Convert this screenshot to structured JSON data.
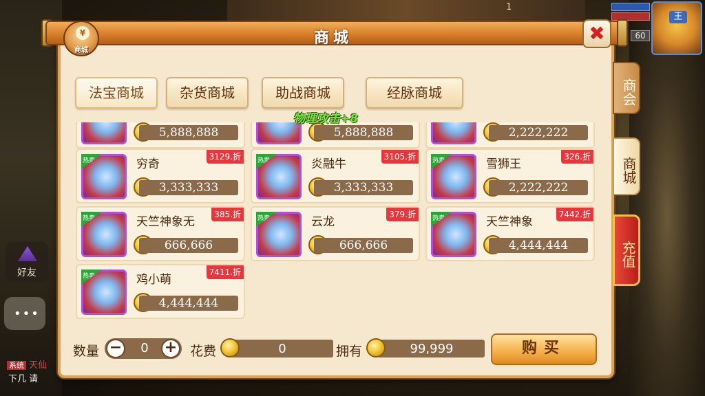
{
  "window": {
    "title": "商城",
    "top_status": "1"
  },
  "shop_icon": {
    "symbol": "¥",
    "label": "商城"
  },
  "close_icon": "close-icon",
  "hud": {
    "level": "60",
    "avatar_mark": "王"
  },
  "tabs": [
    {
      "label": "法宝商城",
      "active": true
    },
    {
      "label": "杂货商城",
      "active": false
    },
    {
      "label": "助战商城",
      "active": false
    },
    {
      "label": "经脉商城",
      "active": false
    }
  ],
  "floating_text": "物理攻击+8",
  "item_tag": "热卖",
  "items": [
    {
      "name": "",
      "discount": "",
      "price": "5,888,888"
    },
    {
      "name": "",
      "discount": "",
      "price": "5,888,888"
    },
    {
      "name": "",
      "discount": "",
      "price": "2,222,222"
    },
    {
      "name": "穷奇",
      "discount": "3129.折",
      "price": "3,333,333"
    },
    {
      "name": "炎融牛",
      "discount": "3105.折",
      "price": "3,333,333"
    },
    {
      "name": "雪狮王",
      "discount": "326.折",
      "price": "2,222,222"
    },
    {
      "name": "天竺神象无",
      "discount": "385.折",
      "price": "666,666"
    },
    {
      "name": "云龙",
      "discount": "379.折",
      "price": "666,666"
    },
    {
      "name": "天竺神象",
      "discount": "7442.折",
      "price": "4,444,444"
    },
    {
      "name": "鸡小萌",
      "discount": "7411.折",
      "price": "4,444,444"
    }
  ],
  "bottom": {
    "quantity_label": "数量",
    "quantity_value": "0",
    "minus": "−",
    "plus": "+",
    "cost_label": "花费",
    "cost_value": "0",
    "own_label": "拥有",
    "own_value": "99,999",
    "buy_label": "购买"
  },
  "side_tabs": {
    "guild": "商会",
    "shop": "商城",
    "recharge": "充值"
  },
  "left_ui": {
    "friends_label": "好友",
    "chat_dots": "•••",
    "chat_tag": "系统",
    "chat_text": "天仙",
    "chat_line2": "下几 请"
  },
  "colors": {
    "panel_bg": "#f6e8cf",
    "title_orange": "#d87f2a",
    "discount_red": "#e8363c",
    "float_green": "#7ee14a",
    "price_bar": "#8a6a48"
  }
}
